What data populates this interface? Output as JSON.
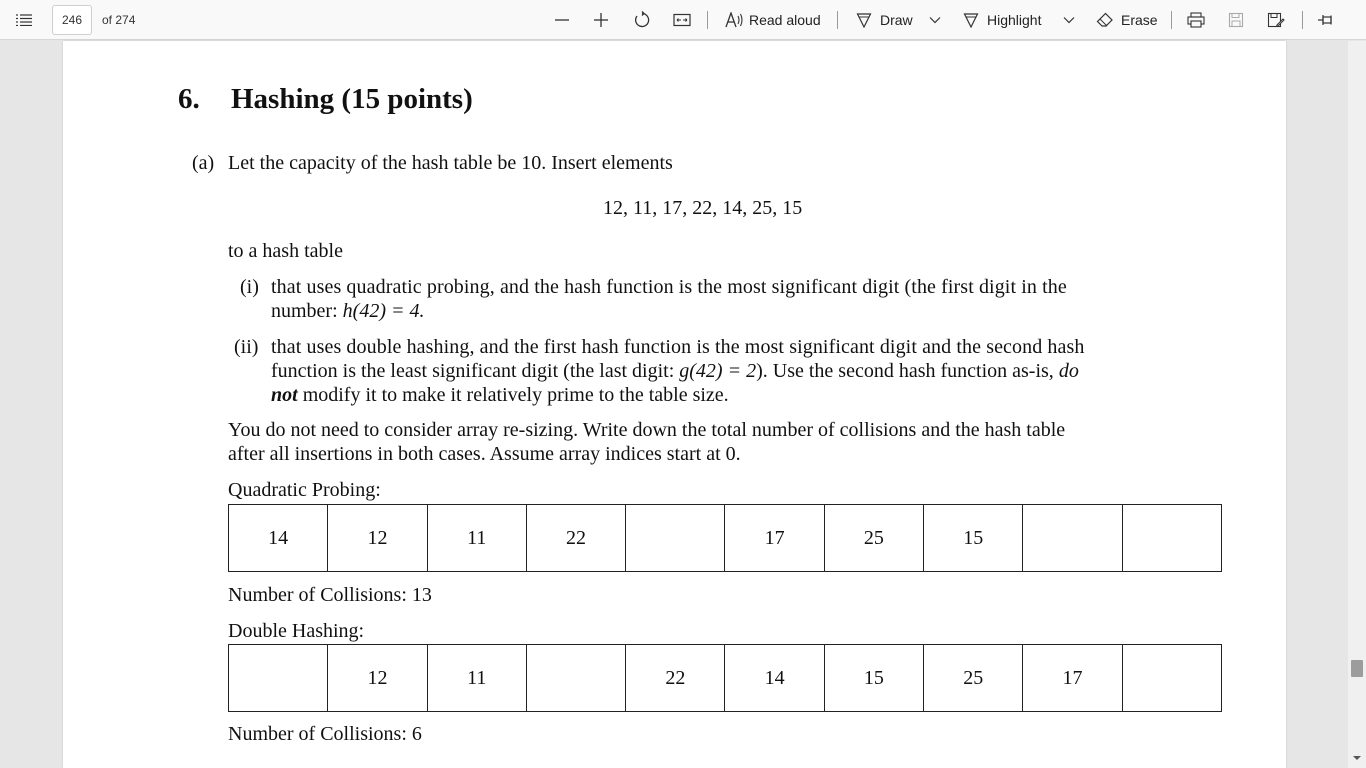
{
  "toolbar": {
    "page_current": "246",
    "page_total": "of 274",
    "read_aloud": "Read aloud",
    "draw": "Draw",
    "highlight": "Highlight",
    "erase": "Erase",
    "icons": [
      "contents-icon",
      "zoom-out-icon",
      "zoom-in-icon",
      "rotate-icon",
      "fit-page-icon",
      "read-aloud-icon",
      "draw-icon",
      "chevron-down-icon",
      "highlight-icon",
      "erase-icon",
      "print-icon",
      "save-icon",
      "save-as-icon",
      "pin-icon"
    ]
  },
  "document": {
    "section_number": "6.",
    "section_title": "Hashing (15 points)",
    "part_a_label": "(a)",
    "part_a_text": "Let the capacity of the hash table be 10. Insert elements",
    "elements": "12, 11, 17, 22, 14, 25, 15",
    "to_table": "to a hash table",
    "i_label": "(i)",
    "i_line1": "that uses quadratic probing, and the hash function is the most significant digit (the first digit in the",
    "i_line2_a": "number: ",
    "i_line2_math": "h(42) = 4.",
    "ii_label": "(ii)",
    "ii_line1": "that uses double hashing, and the first hash function is the most significant digit and the second hash",
    "ii_line2_a": "function is the least significant digit (the last digit: ",
    "ii_line2_math": "g(42) = 2",
    "ii_line2_b": "). Use the second hash function as-is, ",
    "ii_line2_em": "do",
    "ii_line3_strong": "not",
    "ii_line3_rest": " modify it to make it relatively prime to the table size.",
    "note_line1": "You do not need to consider array re-sizing. Write down the total number of collisions and the hash table",
    "note_line2": "after all insertions in both cases. Assume array indices start at 0.",
    "quadratic_label": "Quadratic Probing:",
    "quadratic_cells": [
      "14",
      "12",
      "11",
      "22",
      "",
      "17",
      "25",
      "15",
      "",
      ""
    ],
    "quadratic_collisions": "Number of Collisions: 13",
    "double_label": "Double Hashing:",
    "double_cells": [
      "",
      "12",
      "11",
      "",
      "22",
      "14",
      "15",
      "25",
      "17",
      ""
    ],
    "double_collisions": "Number of Collisions: 6"
  }
}
